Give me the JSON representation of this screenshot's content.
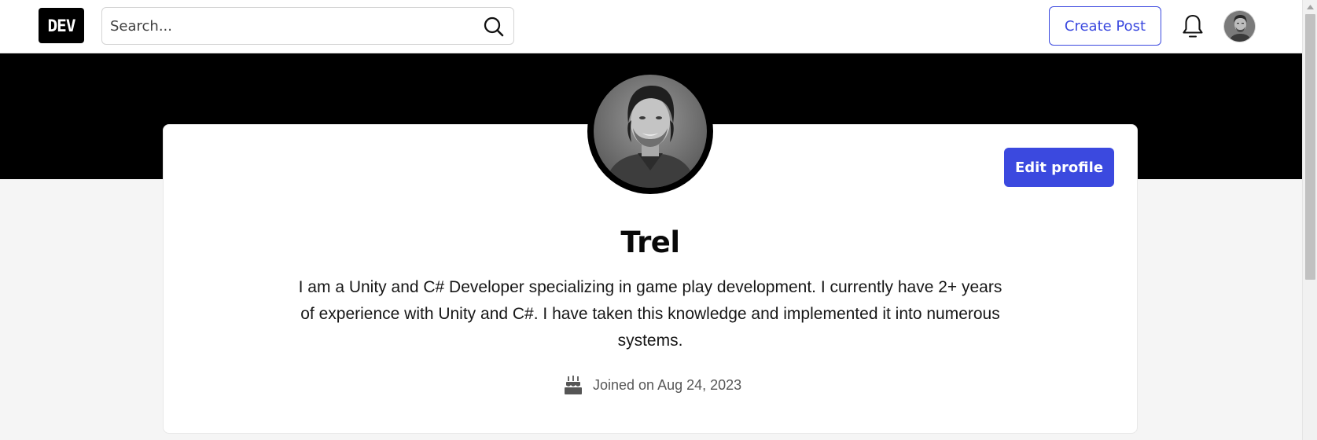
{
  "header": {
    "logo_text": "DEV",
    "search": {
      "placeholder": "Search...",
      "value": ""
    },
    "create_post_label": "Create Post",
    "icons": {
      "search": "search-icon",
      "notifications": "bell-icon"
    }
  },
  "profile": {
    "name": "Trel",
    "bio": "I am a Unity and C# Developer specializing in game play development. I currently have 2+ years of experience with Unity and C#. I have taken this knowledge and implemented it into numerous systems.",
    "joined": "Joined on Aug 24, 2023",
    "edit_profile_label": "Edit profile",
    "icons": {
      "joined": "cake-icon"
    }
  },
  "colors": {
    "accent": "#3b49df",
    "banner": "#000000",
    "page_background": "#f5f5f5"
  }
}
